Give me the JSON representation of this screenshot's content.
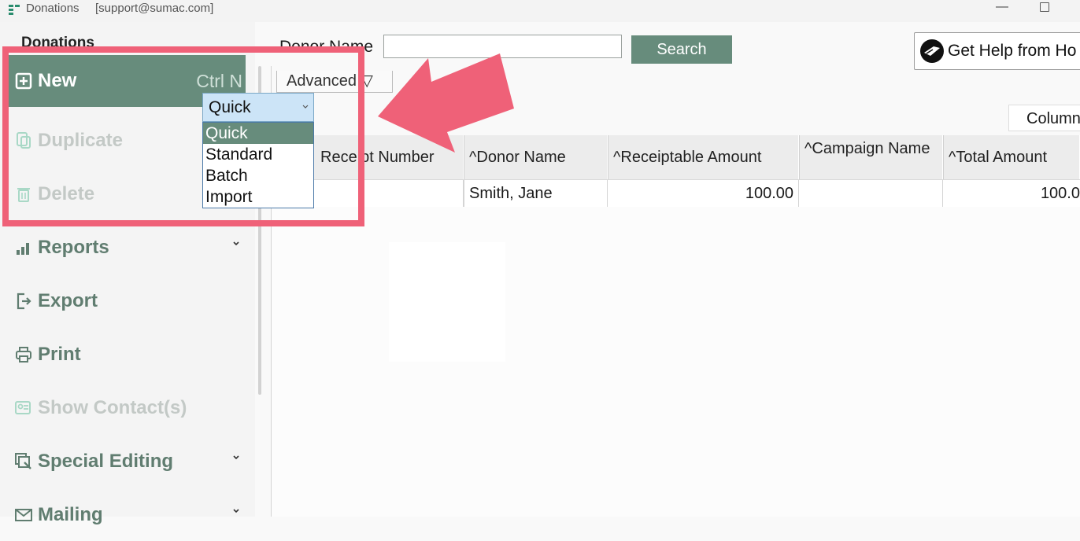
{
  "window": {
    "title": "Donations",
    "user": "[support@sumac.com]",
    "minimize_glyph": "—"
  },
  "sidebar": {
    "heading": "Donations",
    "items": [
      {
        "label": "New",
        "shortcut": "Ctrl N",
        "icon": "plus-square-icon",
        "state": "active"
      },
      {
        "label": "Duplicate",
        "icon": "duplicate-icon",
        "state": "disabled"
      },
      {
        "label": "Delete",
        "icon": "trash-icon",
        "state": "disabled"
      },
      {
        "label": "Reports",
        "icon": "bar-chart-icon",
        "state": "normal",
        "expandable": true
      },
      {
        "label": "Export",
        "icon": "export-icon",
        "state": "normal"
      },
      {
        "label": "Print",
        "icon": "printer-icon",
        "state": "normal"
      },
      {
        "label": "Show Contact(s)",
        "icon": "contact-card-icon",
        "state": "disabled"
      },
      {
        "label": "Special Editing",
        "icon": "special-editing-icon",
        "state": "normal",
        "expandable": true
      },
      {
        "label": "Mailing",
        "icon": "mail-icon",
        "state": "normal",
        "expandable": true
      }
    ]
  },
  "search": {
    "label": "Donor Name",
    "value": "",
    "button_label": "Search",
    "advanced_label": "Advanced ▽"
  },
  "help": {
    "label": "Get Help from Ho"
  },
  "columns_button": "Column",
  "grid": {
    "headers": [
      "Receipt Number",
      "^Donor Name",
      "^Receiptable Amount",
      "^Campaign Name",
      "^Total Amount"
    ],
    "rows": [
      [
        "",
        "Smith, Jane",
        "100.00",
        "",
        "100.0"
      ]
    ]
  },
  "new_type_dropdown": {
    "selected": "Quick",
    "options": [
      "Quick",
      "Standard",
      "Batch",
      "Import"
    ]
  },
  "colors": {
    "accent": "#678c7c",
    "highlight": "#ef6178"
  }
}
